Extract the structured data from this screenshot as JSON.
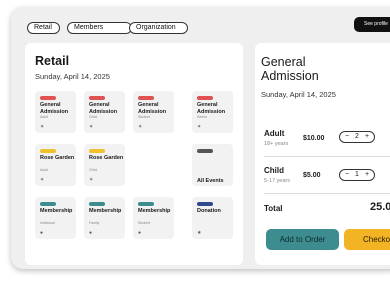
{
  "filters": [
    {
      "label": "Retail"
    },
    {
      "label": "Members"
    },
    {
      "label": "Organization"
    }
  ],
  "header": {
    "profile_label": "See profile"
  },
  "left": {
    "title": "Retail",
    "date": "Sunday, April 14, 2025",
    "tiles": [
      {
        "name": "General Admission",
        "sub": "Adult",
        "color": "#e05252",
        "icon": "ticket-icon"
      },
      {
        "name": "General Admission",
        "sub": "Child",
        "color": "#e05252",
        "icon": "ticket-icon"
      },
      {
        "name": "General Admission",
        "sub": "Student",
        "color": "#e05252",
        "icon": "ticket-icon"
      },
      {
        "name": "General Admission",
        "sub": "Senior",
        "color": "#e05252",
        "icon": "ticket-icon"
      },
      {
        "name": "Rose Garden",
        "sub": "Adult",
        "color": "#f2c12e",
        "icon": "ticket-icon"
      },
      {
        "name": "Rose Garden",
        "sub": "Child",
        "color": "#f2c12e",
        "icon": "ticket-icon"
      },
      {
        "name": "All Events",
        "sub": "",
        "color": "#555555",
        "icon": ""
      },
      {
        "name": "Membership",
        "sub": "Individual",
        "color": "#3d8c8f",
        "icon": "person-icon"
      },
      {
        "name": "Membership",
        "sub": "Family",
        "color": "#3d8c8f",
        "icon": "person-icon"
      },
      {
        "name": "Membership",
        "sub": "Student",
        "color": "#3d8c8f",
        "icon": "person-icon"
      },
      {
        "name": "Donation",
        "sub": "",
        "color": "#2e4a8c",
        "icon": "star-icon"
      }
    ]
  },
  "right": {
    "title": "General Admission",
    "date": "Sunday, April 14, 2025",
    "tickets": [
      {
        "name": "Adult",
        "sub": "18+ years",
        "price": "$10.00",
        "qty": "2"
      },
      {
        "name": "Child",
        "sub": "5-17 years",
        "price": "$5.00",
        "qty": "1"
      }
    ],
    "total_label": "Total",
    "total_value": "25.0",
    "minus": "−",
    "plus": "+"
  },
  "actions": {
    "add_label": "Add to Order",
    "checkout_label": "Checkout"
  },
  "colors": {
    "accent_teal": "#3d8c8f",
    "accent_yellow": "#f2b424",
    "red": "#e05252",
    "navy": "#2e4a8c"
  }
}
